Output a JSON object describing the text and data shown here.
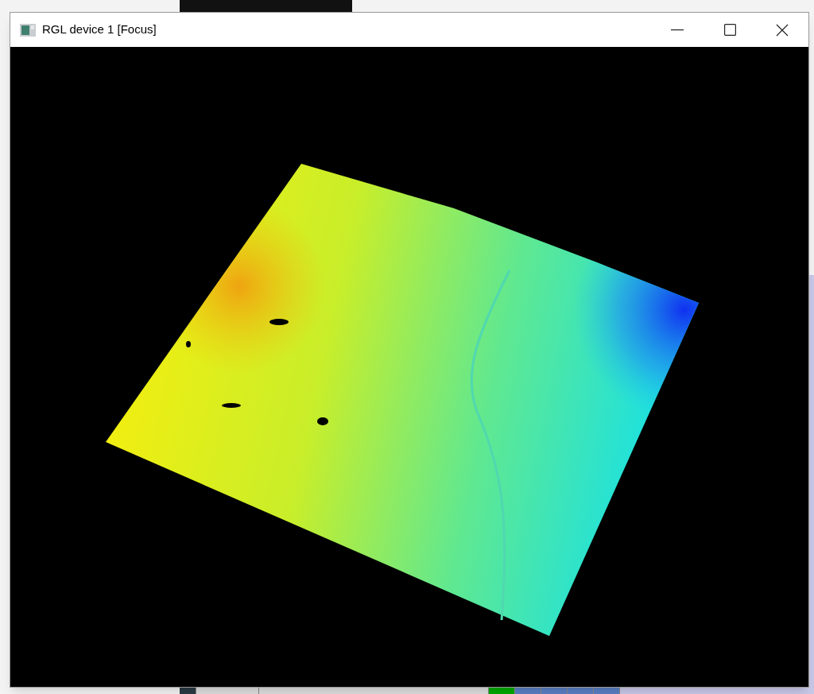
{
  "window": {
    "title": "RGL device 1 [Focus]"
  }
}
